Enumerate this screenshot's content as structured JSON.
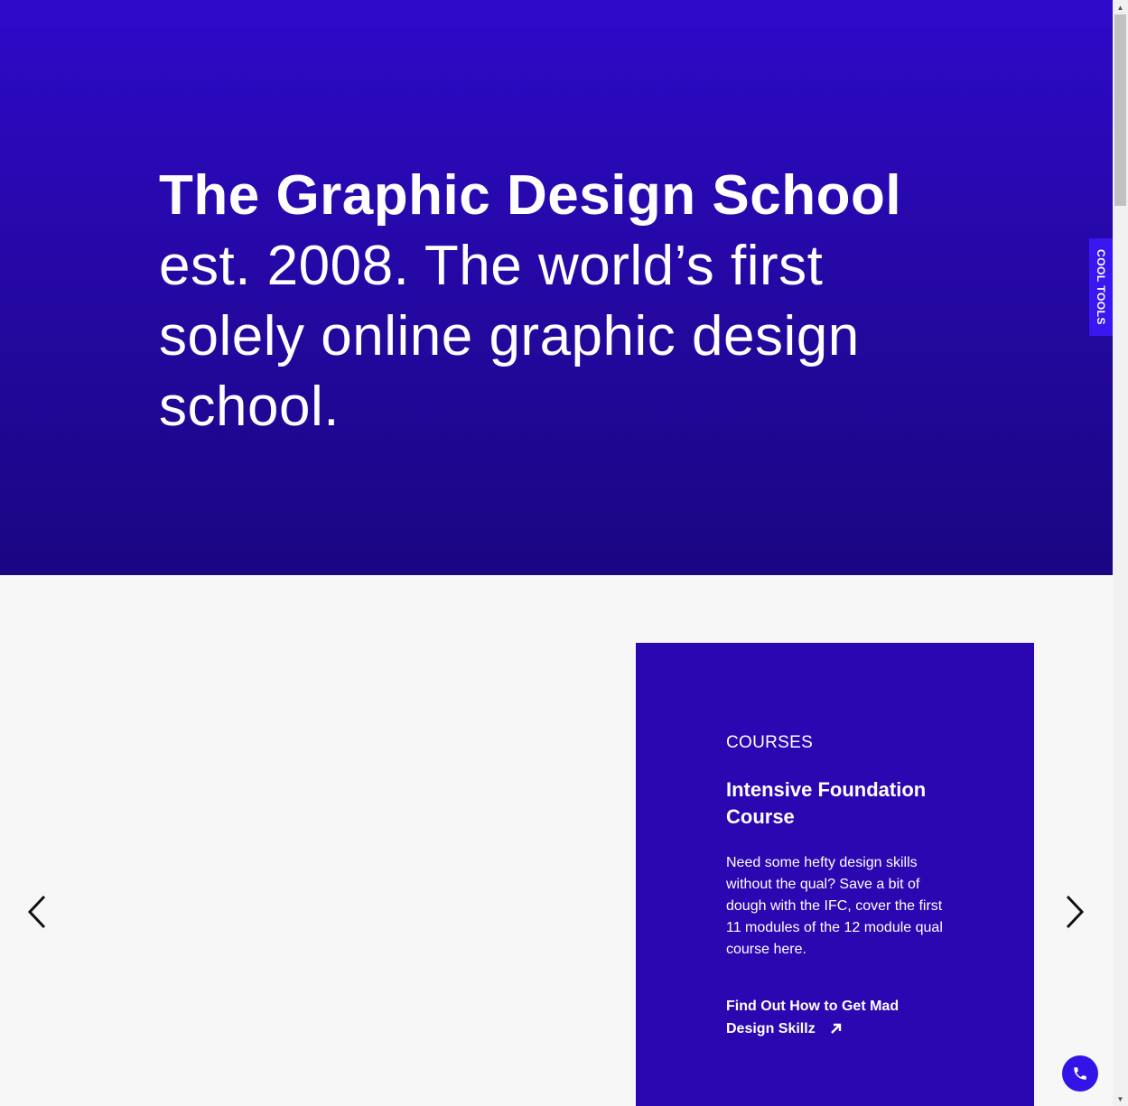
{
  "hero": {
    "title": "The Graphic Design School",
    "subtitle": "est. 2008. The world’s first solely online graphic design school."
  },
  "side_tab": {
    "label": "COOL TOOLS"
  },
  "carousel": {
    "prev_icon": "chevron-left-icon",
    "next_icon": "chevron-right-icon",
    "card": {
      "category": "COURSES",
      "title": "Intensive Foundation Course",
      "description": "Need some hefty design skills without the qual? Save a bit of dough with the IFC, cover the first 11 modules of the 12 module qual course here.",
      "link_label": "Find Out How to Get Mad Design Skillz",
      "link_icon": "arrow-up-right-icon"
    }
  },
  "call_button": {
    "icon": "phone-icon"
  },
  "colors": {
    "hero_top": "#2d0ac9",
    "hero_bottom": "#1a0583",
    "card_bg": "#2a07b0",
    "accent": "#3314e8",
    "page_bg": "#f7f7f7"
  }
}
